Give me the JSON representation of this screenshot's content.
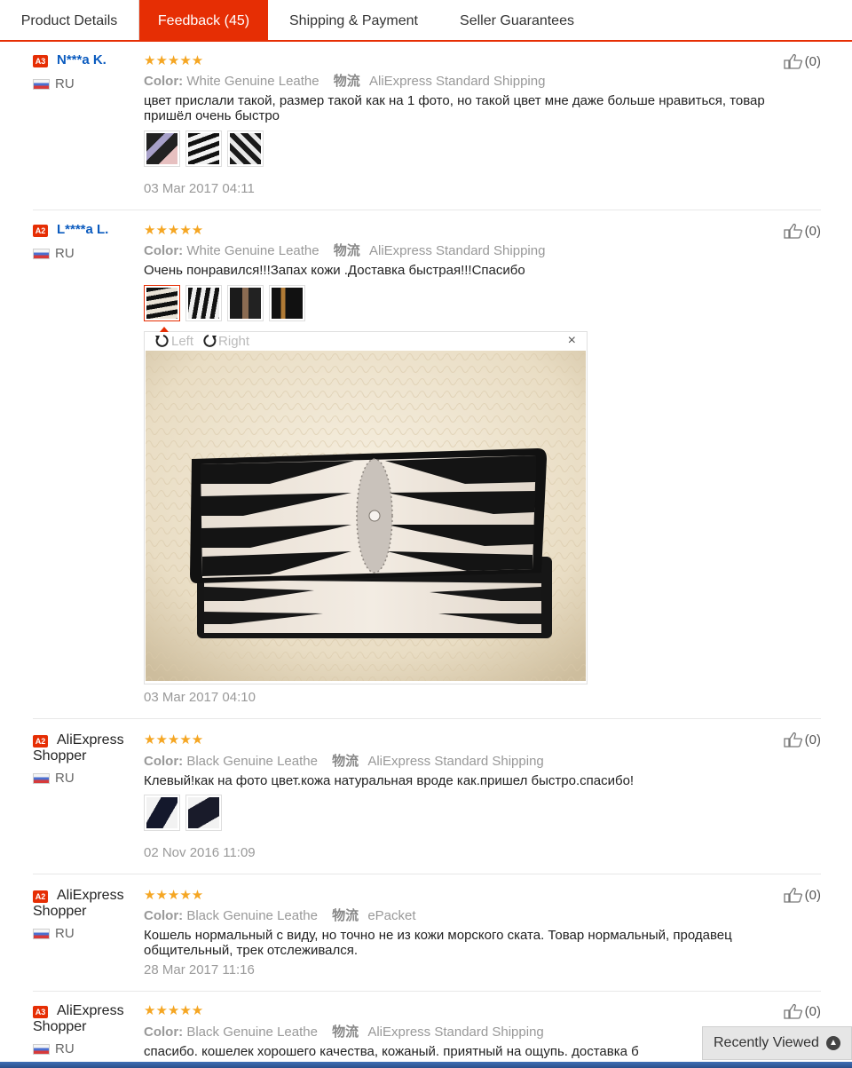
{
  "tabs": [
    {
      "label": "Product Details"
    },
    {
      "label": "Feedback (45)"
    },
    {
      "label": "Shipping & Payment"
    },
    {
      "label": "Seller Guarantees"
    }
  ],
  "reviews": [
    {
      "badge": "A3",
      "name": "N***a K.",
      "country": "RU",
      "stars": "★★★★★",
      "color_label": "Color:",
      "color_value": "White Genuine Leathe",
      "logistics_label": "物流",
      "logistics_value": "AliExpress Standard Shipping",
      "text": "цвет прислали такой, размер такой как на 1 фото, но такой цвет мне даже больше нравиться, товар пришёл очень быстро",
      "date": "03 Mar 2017 04:11",
      "helpful": "(0)"
    },
    {
      "badge": "A2",
      "name": "L****a L.",
      "country": "RU",
      "stars": "★★★★★",
      "color_label": "Color:",
      "color_value": "White Genuine Leathe",
      "logistics_label": "物流",
      "logistics_value": "AliExpress Standard Shipping",
      "text": "Очень понравился!!!Запах кожи .Доставка быстрая!!!Спасибо",
      "date": "03 Mar 2017 04:10",
      "helpful": "(0)"
    },
    {
      "badge": "A2",
      "name_line1": "AliExpress",
      "name_line2": "Shopper",
      "country": "RU",
      "stars": "★★★★★",
      "color_label": "Color:",
      "color_value": "Black Genuine Leathe",
      "logistics_label": "物流",
      "logistics_value": "AliExpress Standard Shipping",
      "text": "Клевый!как на фото цвет.кожа натуральная вроде как.пришел быстро.спасибо!",
      "date": "02 Nov 2016 11:09",
      "helpful": "(0)"
    },
    {
      "badge": "A2",
      "name_line1": "AliExpress",
      "name_line2": "Shopper",
      "country": "RU",
      "stars": "★★★★★",
      "color_label": "Color:",
      "color_value": "Black Genuine Leathe",
      "logistics_label": "物流",
      "logistics_value": "ePacket",
      "text": "Кошель нормальный с виду, но точно не из кожи морского ската. Товар нормальный, продавец общительный, трек отслеживался.",
      "date": "28 Mar 2017 11:16",
      "helpful": "(0)"
    },
    {
      "badge": "A3",
      "name_line1": "AliExpress",
      "name_line2": "Shopper",
      "country": "RU",
      "stars": "★★★★★",
      "color_label": "Color:",
      "color_value": "Black Genuine Leathe",
      "logistics_label": "物流",
      "logistics_value": "AliExpress Standard Shipping",
      "text": "спасибо. кошелек хорошего качества, кожаный. приятный на ощупь. доставка б",
      "helpful": "(0)"
    }
  ],
  "viewer": {
    "rotate_left": "Left",
    "rotate_right": "Right",
    "close": "×"
  },
  "recently_viewed": "Recently Viewed",
  "colors": {
    "accent": "#e62e04",
    "star": "#f5a623",
    "link": "#0b5bbf"
  }
}
